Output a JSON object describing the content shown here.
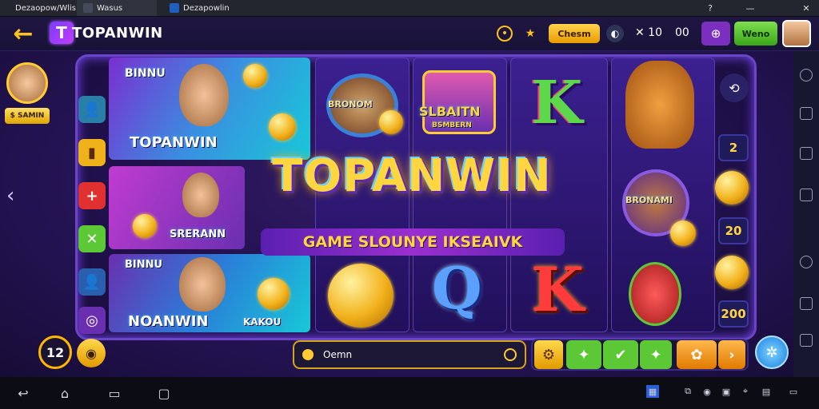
{
  "tabs": [
    {
      "label": "Dezaopow/Wlis",
      "color": "#2e8b57"
    },
    {
      "label": "Wasus",
      "color": "#444a5a"
    },
    {
      "label": "Dezapowlin",
      "color": "#1f5fbf"
    }
  ],
  "window": {
    "help": "?",
    "minimize": "—",
    "close": "✕"
  },
  "header": {
    "back": "←",
    "logo_letter": "T",
    "logo_text": "TOPANWIN",
    "chest_label": "Chesm",
    "multiplier": "✕ 10",
    "zeros": "00",
    "wallet_label": "Weno"
  },
  "player": {
    "tag": "$ SAMIN"
  },
  "side_buttons": [
    "👤",
    "▮",
    "+",
    "✕",
    "👤",
    "◎"
  ],
  "cards": {
    "c1_title": "BINNU",
    "c1_name": "TOPANWIN",
    "c2_title": "SRERANN",
    "c3_title": "BINNU",
    "c3_name": "NOANWIN",
    "c3_tag": "KAKOU",
    "reel2_label": "BRONOM",
    "reel3_label": "SLBAITN",
    "reel3_sub": "BSMBERN",
    "reel5_label": "BRONAMI"
  },
  "symbols": {
    "k_top": "K",
    "q": "Q",
    "k_bottom": "K"
  },
  "main": {
    "title": "TOPANWIN",
    "subtitle": "GAME SLOUNYE IKSEAIVK"
  },
  "num_tiles": [
    "2",
    "20",
    "200"
  ],
  "bottom": {
    "level": "12",
    "bet_icon": "◉",
    "search_value": "Oemn",
    "ctrl_icons": [
      "⚙",
      "✦",
      "✔",
      "✦",
      "✿",
      "›"
    ],
    "spin_icon": "✲"
  },
  "colors": {
    "accent_gold": "#ffd640",
    "frame_purple": "#6b45c8",
    "green": "#5cc836",
    "background": "#120a2a"
  }
}
